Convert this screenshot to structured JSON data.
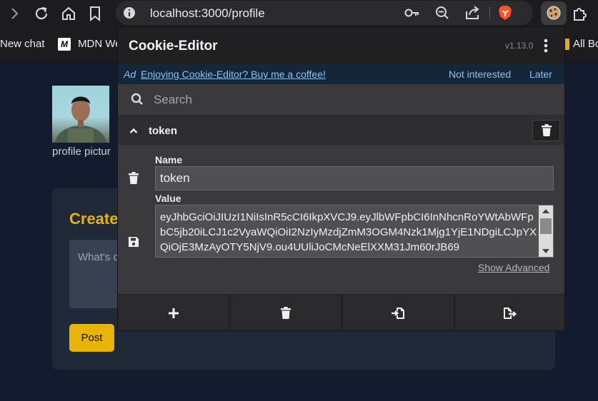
{
  "browser": {
    "url": "localhost:3000/profile",
    "bookmarks": [
      "New chat",
      "MDN We",
      "All Bo"
    ]
  },
  "page": {
    "profile_label": "profile pictur",
    "create_title": "Create",
    "create_placeholder": "What's c",
    "post_button": "Post"
  },
  "popup": {
    "title": "Cookie-Editor",
    "version": "v1.13.0",
    "ad": {
      "tag": "Ad",
      "text": "Enjoying Cookie-Editor? Buy me a coffee!",
      "not_interested": "Not interested",
      "later": "Later"
    },
    "search_placeholder": "Search",
    "cookie": {
      "header_name": "token",
      "name_label": "Name",
      "name_value": "token",
      "value_label": "Value",
      "value": "eyJhbGciOiJIUzI1NiIsInR5cCI6IkpXVCJ9.eyJlbWFpbCI6InNhcnRoYWtAbWFpbC5jb20iLCJ1c2VyaWQiOiI2NzIyMzdjZmM3OGM4Nzk1Mjg1YjE1NDgiLCJpYXQiOjE3MzAyOTY5NjV9.ou4UUliJoCMcNeElXXM31Jm60rJB69",
      "show_advanced": "Show Advanced"
    },
    "footer_icons": [
      "add-icon",
      "delete-all-icon",
      "import-icon",
      "export-icon"
    ]
  },
  "colors": {
    "accent_yellow": "#eab308",
    "ad_link": "#8fc1ea",
    "brave_orange": "#fb542b"
  }
}
